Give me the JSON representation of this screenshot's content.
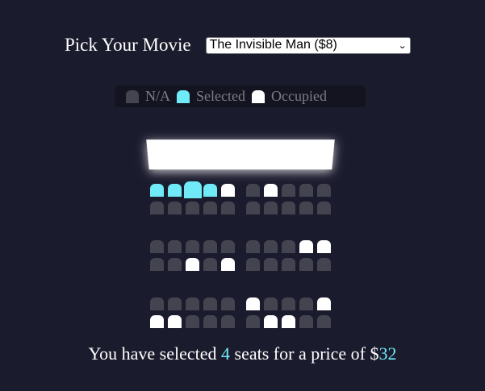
{
  "picker": {
    "label": "Pick Your Movie",
    "selected_option": "The Invisible Man ($8)",
    "dropdown_icon": "chevron-down-icon"
  },
  "legend": [
    {
      "label": "N/A",
      "color": "#444451"
    },
    {
      "label": "Selected",
      "color": "#6feaf6"
    },
    {
      "label": "Occupied",
      "color": "#ffffff"
    }
  ],
  "colors": {
    "background": "#1b1b2e",
    "accent": "#6feaf6",
    "seat_na": "#444451",
    "seat_selected": "#6feaf6",
    "seat_occupied": "#ffffff"
  },
  "seat_rows": [
    [
      "selected",
      "selected",
      "selected",
      "selected",
      "occupied",
      "na",
      "occupied",
      "na",
      "na",
      "na"
    ],
    [
      "na",
      "na",
      "na",
      "na",
      "na",
      "na",
      "na",
      "na",
      "na",
      "na"
    ],
    [
      "na",
      "na",
      "na",
      "na",
      "na",
      "na",
      "na",
      "na",
      "occupied",
      "occupied"
    ],
    [
      "na",
      "na",
      "occupied",
      "na",
      "occupied",
      "na",
      "na",
      "na",
      "na",
      "na"
    ],
    [
      "na",
      "na",
      "na",
      "na",
      "na",
      "occupied",
      "na",
      "na",
      "na",
      "occupied"
    ],
    [
      "occupied",
      "occupied",
      "na",
      "na",
      "na",
      "na",
      "occupied",
      "occupied",
      "na",
      "na"
    ]
  ],
  "summary": {
    "prefix": "You have selected ",
    "count": "4",
    "middle": " seats for a price of $",
    "price": "32"
  }
}
